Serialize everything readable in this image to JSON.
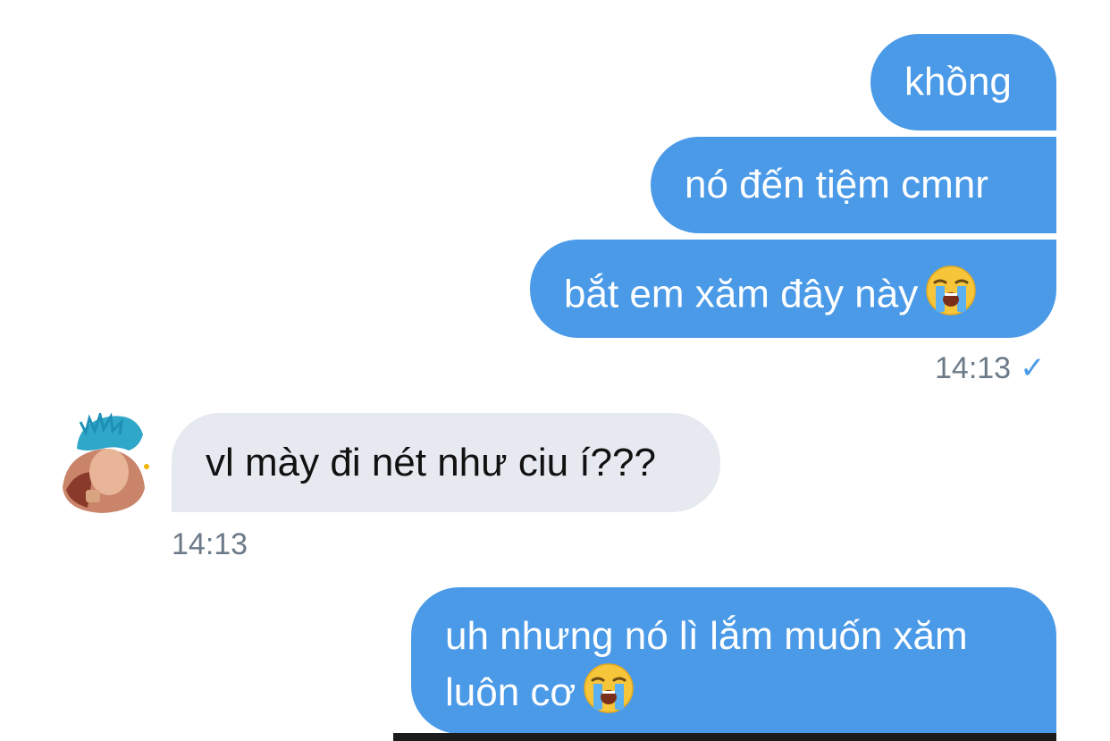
{
  "messages": [
    {
      "text": "khồng"
    },
    {
      "text": "nó đến tiệm cmnr"
    },
    {
      "text": "bắt em xăm đây này"
    },
    {
      "time": "14:13",
      "status": "✓"
    },
    {
      "text": "vl mày đi nét như ciu í???",
      "time": "14:13"
    },
    {
      "line1": "uh nhưng nó lì lắm muốn xăm",
      "line2": "luôn cơ"
    }
  ],
  "emoji": "loudly-crying-face",
  "colors": {
    "outgoing": "#4a9ae8",
    "incoming": "#e6e9f0",
    "timestamp": "#6c7a88"
  }
}
